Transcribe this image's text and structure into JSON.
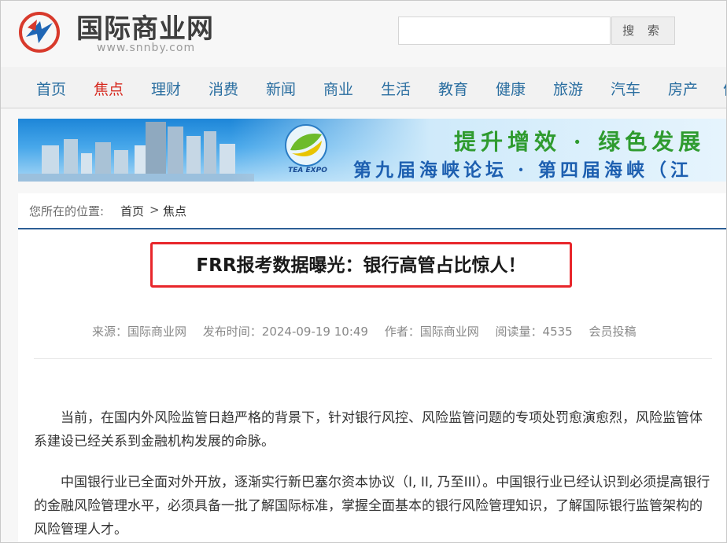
{
  "header": {
    "site_name": "国际商业网",
    "site_url": "www.snnby.com",
    "search": {
      "placeholder": "",
      "button_label": "搜 索"
    }
  },
  "nav": {
    "items": [
      "首页",
      "焦点",
      "理财",
      "消费",
      "新闻",
      "商业",
      "生活",
      "教育",
      "健康",
      "旅游",
      "汽车",
      "房产",
      "体"
    ],
    "active": "焦点"
  },
  "banner": {
    "logo_text": "TEA EXPO",
    "line1": "提升增效 · 绿色发展",
    "line2": "第九届海峡论坛 · 第四届海峡（江"
  },
  "breadcrumb": {
    "label": "您所在的位置:",
    "home": "首页",
    "separator": ">",
    "current": "焦点"
  },
  "article": {
    "title": "FRR报考数据曝光：银行高管占比惊人！",
    "meta": {
      "source": "来源：国际商业网",
      "published": "发布时间：2024-09-19 10:49",
      "author": "作者：国际商业网",
      "reads": "阅读量：4535",
      "submit": "会员投稿"
    },
    "paragraphs": [
      "当前，在国内外风险监管日趋严格的背景下，针对银行风控、风险监管问题的专项处罚愈演愈烈，风险监管体系建设已经关系到金融机构发展的命脉。",
      "中国银行业已全面对外开放，逐渐实行新巴塞尔资本协议（I, II, 乃至III）。中国银行业已经认识到必须提高银行的金融风险管理水平，必须具备一批了解国际标准，掌握全面基本的银行风险管理知识，了解国际银行监管架构的风险管理人才。"
    ]
  },
  "colors": {
    "nav_link": "#2a6ea0",
    "nav_active": "#d62a20",
    "title_border": "#e8262b",
    "breadcrumb_rule": "#2d5f95"
  }
}
